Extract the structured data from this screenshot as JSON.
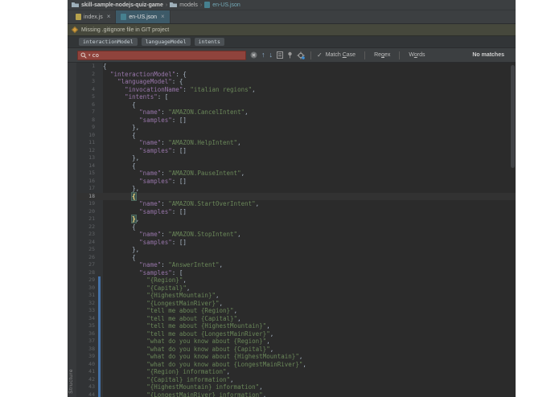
{
  "colors": {
    "editor_bg": "#2b2b2b",
    "panel_bg": "#3c3f41",
    "key": "#9876aa",
    "string": "#6a8759",
    "text": "#a9b7c6",
    "no_match_bg": "#8f433c",
    "selected_tab_bg": "#3d5a68",
    "changed_marker": "#4572a8",
    "warning_icon": "#d19a3f"
  },
  "nav": {
    "project": "skill-sample-nodejs-quiz-game",
    "folder": "models",
    "file": "en-US.json",
    "separator": "›"
  },
  "tabs": [
    {
      "label": "index.js",
      "icon": "js-file-icon",
      "selected": false,
      "close": "×"
    },
    {
      "label": "en-US.json",
      "icon": "json-file-icon",
      "selected": true,
      "close": "×"
    }
  ],
  "notification": {
    "text": "Missing .gitignore file in GIT project"
  },
  "breadcrumbs": [
    {
      "label": "interactionModel"
    },
    {
      "label": "languageModel"
    },
    {
      "label": "intents"
    }
  ],
  "find": {
    "query": "co",
    "status": "No matches",
    "check_glyph": "✓",
    "options": [
      {
        "label": "Match Case",
        "mnemonic": "C"
      },
      {
        "label": "Regex",
        "mnemonic": "g"
      },
      {
        "label": "Words",
        "mnemonic": "o"
      }
    ]
  },
  "tool_window": {
    "label": "Structure"
  },
  "editor": {
    "current_line": 18,
    "matched_brace_lines": [
      18,
      21
    ],
    "changed_lines_start": 29,
    "changed_lines_end": 44,
    "lines": [
      "{",
      "  \"interactionModel\": {",
      "    \"languageModel\": {",
      "      \"invocationName\": \"italian regions\",",
      "      \"intents\": [",
      "        {",
      "          \"name\": \"AMAZON.CancelIntent\",",
      "          \"samples\": []",
      "        },",
      "        {",
      "          \"name\": \"AMAZON.HelpIntent\",",
      "          \"samples\": []",
      "        },",
      "        {",
      "          \"name\": \"AMAZON.PauseIntent\",",
      "          \"samples\": []",
      "        },",
      "        {",
      "          \"name\": \"AMAZON.StartOverIntent\",",
      "          \"samples\": []",
      "        },",
      "        {",
      "          \"name\": \"AMAZON.StopIntent\",",
      "          \"samples\": []",
      "        },",
      "        {",
      "          \"name\": \"AnswerIntent\",",
      "          \"samples\": [",
      "            \"{Region}\",",
      "            \"{Capital}\",",
      "            \"{HighestMountain}\",",
      "            \"{LongestMainRiver}\",",
      "            \"tell me about {Region}\",",
      "            \"tell me about {Capital}\",",
      "            \"tell me about {HighestMountain}\",",
      "            \"tell me about {LongestMainRiver}\",",
      "            \"what do you know about {Region}\",",
      "            \"what do you know about {Capital}\",",
      "            \"what do you know about {HighestMountain}\",",
      "            \"what do you know about {LongestMainRiver}\",",
      "            \"{Region} information\",",
      "            \"{Capital} information\",",
      "            \"{HighestMountain} information\",",
      "            \"{LongestMainRiver} information\","
    ]
  }
}
